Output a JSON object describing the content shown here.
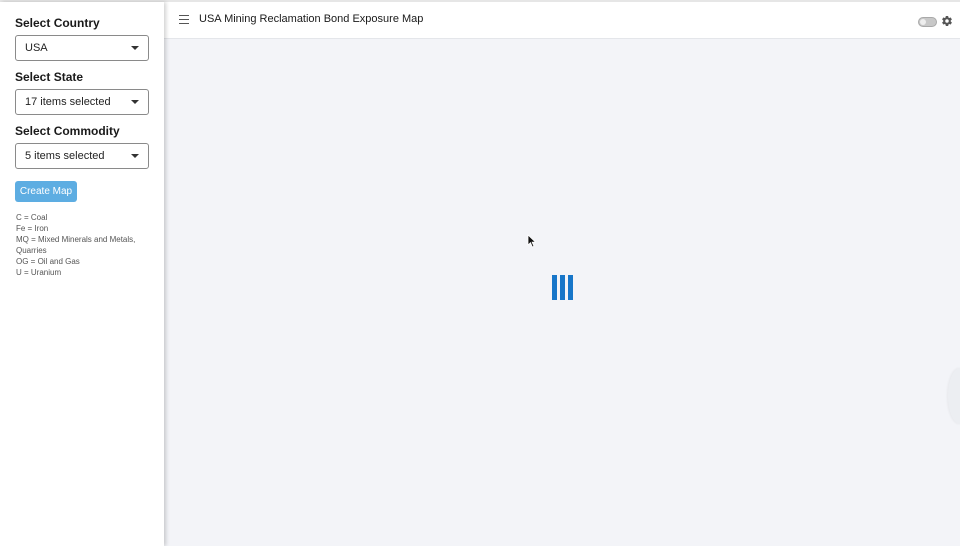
{
  "sidebar": {
    "country": {
      "label": "Select Country",
      "value": "USA"
    },
    "state": {
      "label": "Select State",
      "value": "17 items selected"
    },
    "commodity": {
      "label": "Select Commodity",
      "value": "5 items selected"
    },
    "create_button": "Create Map",
    "legend": [
      "C = Coal",
      "Fe = Iron",
      "MQ = Mixed Minerals and Metals, Quarries",
      "OG = Oil and Gas",
      "U = Uranium"
    ]
  },
  "header": {
    "title": "USA Mining Reclamation Bond Exposure Map",
    "menu_icon": "hamburger-icon",
    "toggle_icon": "toggle-switch",
    "settings_icon": "gear-icon"
  },
  "main": {
    "loading_icon": "loading-spinner"
  },
  "colors": {
    "accent_button": "#5dade2",
    "spinner": "#1776c9",
    "main_background": "#f3f4f8"
  }
}
